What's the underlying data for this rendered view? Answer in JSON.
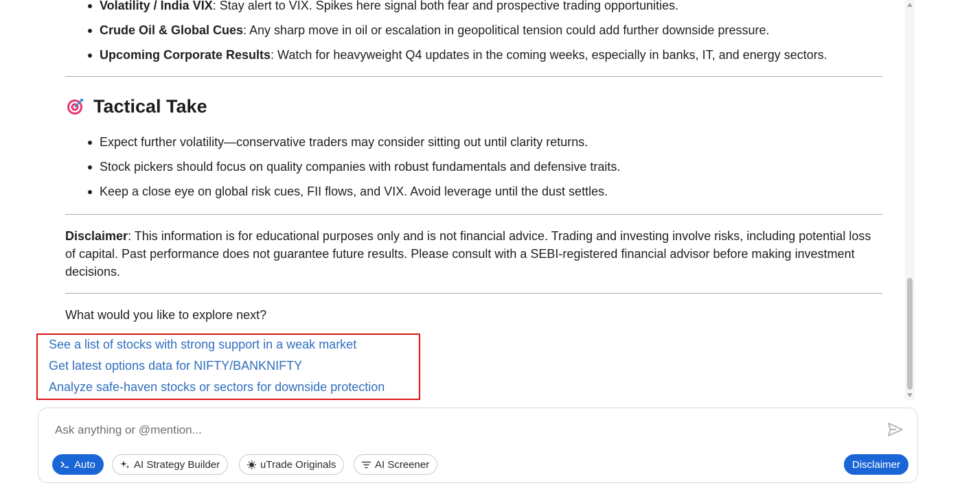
{
  "top_bullets": [
    {
      "label": "Volatility / India VIX",
      "text": ": Stay alert to VIX. Spikes here signal both fear and prospective trading opportunities."
    },
    {
      "label": "Crude Oil & Global Cues",
      "text": ": Any sharp move in oil or escalation in geopolitical tension could add further downside pressure."
    },
    {
      "label": "Upcoming Corporate Results",
      "text": ": Watch for heavyweight Q4 updates in the coming weeks, especially in banks, IT, and energy sectors."
    }
  ],
  "tactical": {
    "heading": "Tactical Take",
    "icon": "bullseye-dart-icon",
    "bullets": [
      "Expect further volatility—conservative traders may consider sitting out until clarity returns.",
      "Stock pickers should focus on quality companies with robust fundamentals and defensive traits.",
      "Keep a close eye on global risk cues, FII flows, and VIX. Avoid leverage until the dust settles."
    ]
  },
  "disclaimer": {
    "label": "Disclaimer",
    "text": ": This information is for educational purposes only and is not financial advice. Trading and investing involve risks, including potential loss of capital. Past performance does not guarantee future results. Please consult with a SEBI-registered financial advisor before making investment decisions."
  },
  "explore_prompt": "What would you like to explore next?",
  "suggestions": [
    "See a list of stocks with strong support in a weak market",
    "Get latest options data for NIFTY/BANKNIFTY",
    "Analyze safe-haven stocks or sectors for downside protection"
  ],
  "composer": {
    "placeholder": "Ask anything or @mention...",
    "chips": [
      {
        "label": "Auto",
        "icon": "terminal-prompt-icon"
      },
      {
        "label": "AI Strategy Builder",
        "icon": "sparkles-icon"
      },
      {
        "label": "uTrade Originals",
        "icon": "sun-badge-icon"
      },
      {
        "label": "AI Screener",
        "icon": "filter-icon"
      }
    ],
    "disclaimer_button": "Disclaimer",
    "send_icon": "send-icon"
  },
  "colors": {
    "accent": "#1a66d6",
    "link": "#2f6fbe",
    "highlight_border": "#e01414",
    "text": "#1f1f1f"
  }
}
